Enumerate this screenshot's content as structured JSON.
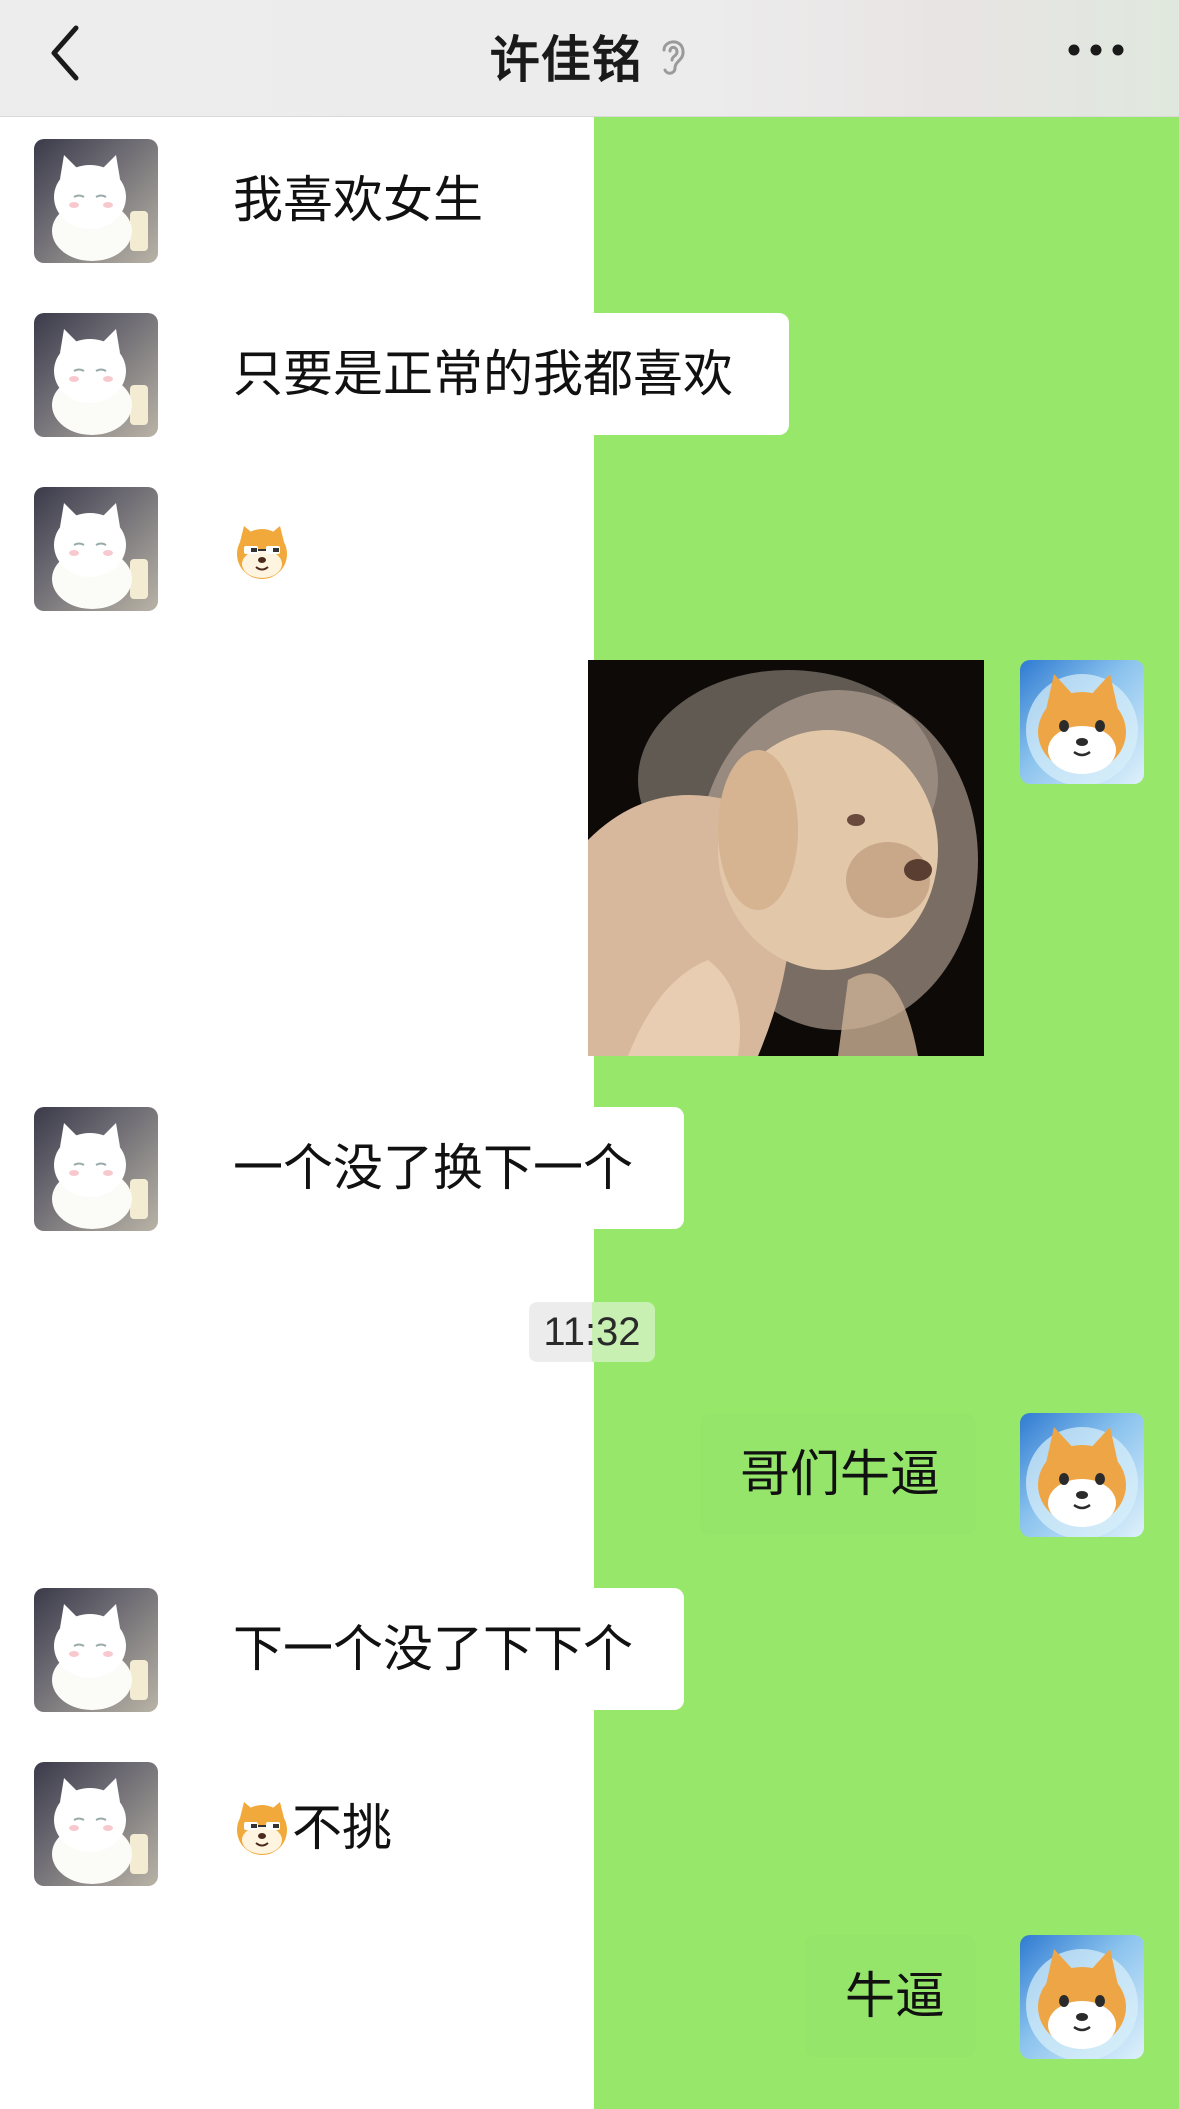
{
  "header": {
    "title": "许佳铭",
    "back_icon": "chevron-left-icon",
    "mode_icon": "ear-icon",
    "more_icon": "more-dots-icon"
  },
  "messages": [
    {
      "side": "incoming",
      "type": "text",
      "text": "我喜欢女生"
    },
    {
      "side": "incoming",
      "type": "text",
      "text": "只要是正常的我都喜欢"
    },
    {
      "side": "incoming",
      "type": "sticker",
      "icon": "doge-emoji"
    },
    {
      "side": "outgoing",
      "type": "image",
      "content": "dog-photo"
    },
    {
      "side": "incoming",
      "type": "text",
      "text": "一个没了换下一个"
    },
    {
      "side": "system",
      "type": "time",
      "text": "11:32"
    },
    {
      "side": "outgoing",
      "type": "text",
      "text": "哥们牛逼"
    },
    {
      "side": "incoming",
      "type": "text",
      "text": "下一个没了下下个"
    },
    {
      "side": "incoming",
      "type": "emoji-text",
      "icon": "doge-emoji",
      "text": "不挑"
    },
    {
      "side": "outgoing",
      "type": "text",
      "text": "牛逼"
    }
  ],
  "colors": {
    "header_bg": "#ededed",
    "outgoing_bubble": "#95e56a",
    "right_background": "#97e86a",
    "incoming_bubble": "#ffffff"
  }
}
